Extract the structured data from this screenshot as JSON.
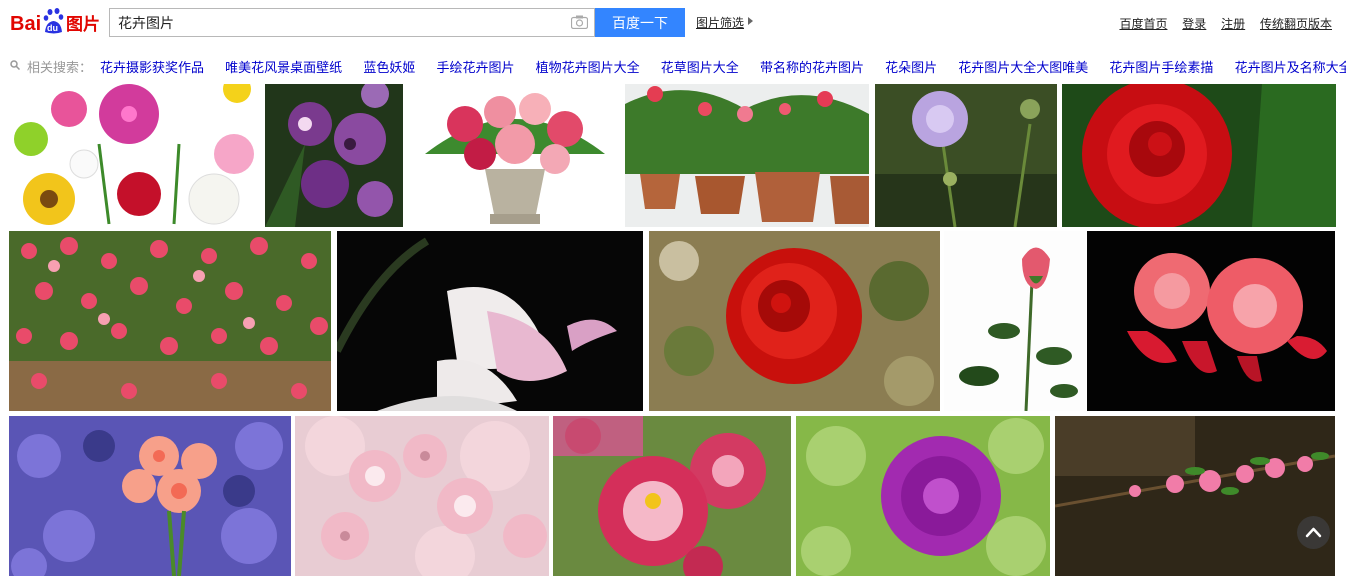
{
  "header": {
    "logo_text": "Bai du 图片",
    "search_value": "花卉图片",
    "search_placeholder": "",
    "search_button": "百度一下",
    "filter_label": "图片筛选"
  },
  "toplinks": [
    "百度首页",
    "登录",
    "注册",
    "传统翻页版本"
  ],
  "related": {
    "label": "相关搜索：",
    "items": [
      "花卉摄影获奖作品",
      "唯美花风景桌面壁纸",
      "蓝色妖姬",
      "手绘花卉图片",
      "植物花卉图片大全",
      "花草图片大全",
      "带名称的花卉图片",
      "花朵图片",
      "花卉图片大全大图唯美",
      "花卉图片手绘素描",
      "花卉图片及名称大全"
    ]
  },
  "images": [
    {
      "name": "mixed-flowers-collage"
    },
    {
      "name": "purple-orchid"
    },
    {
      "name": "pink-rose-vase"
    },
    {
      "name": "potted-geraniums"
    },
    {
      "name": "purple-thistle"
    },
    {
      "name": "red-rose-closeup"
    },
    {
      "name": "climbing-roses-fence"
    },
    {
      "name": "white-magnolia-dark"
    },
    {
      "name": "red-ranunculus"
    },
    {
      "name": "single-rose-stem"
    },
    {
      "name": "red-begonias"
    },
    {
      "name": "blue-primroses"
    },
    {
      "name": "pink-cherry-blossoms"
    },
    {
      "name": "pink-asters"
    },
    {
      "name": "purple-spiky-flower"
    },
    {
      "name": "peach-blossom-branch"
    }
  ],
  "colors": {
    "brand_red": "#e10601",
    "brand_blue": "#2932e1",
    "button": "#3385ff",
    "link": "#0000cc"
  }
}
